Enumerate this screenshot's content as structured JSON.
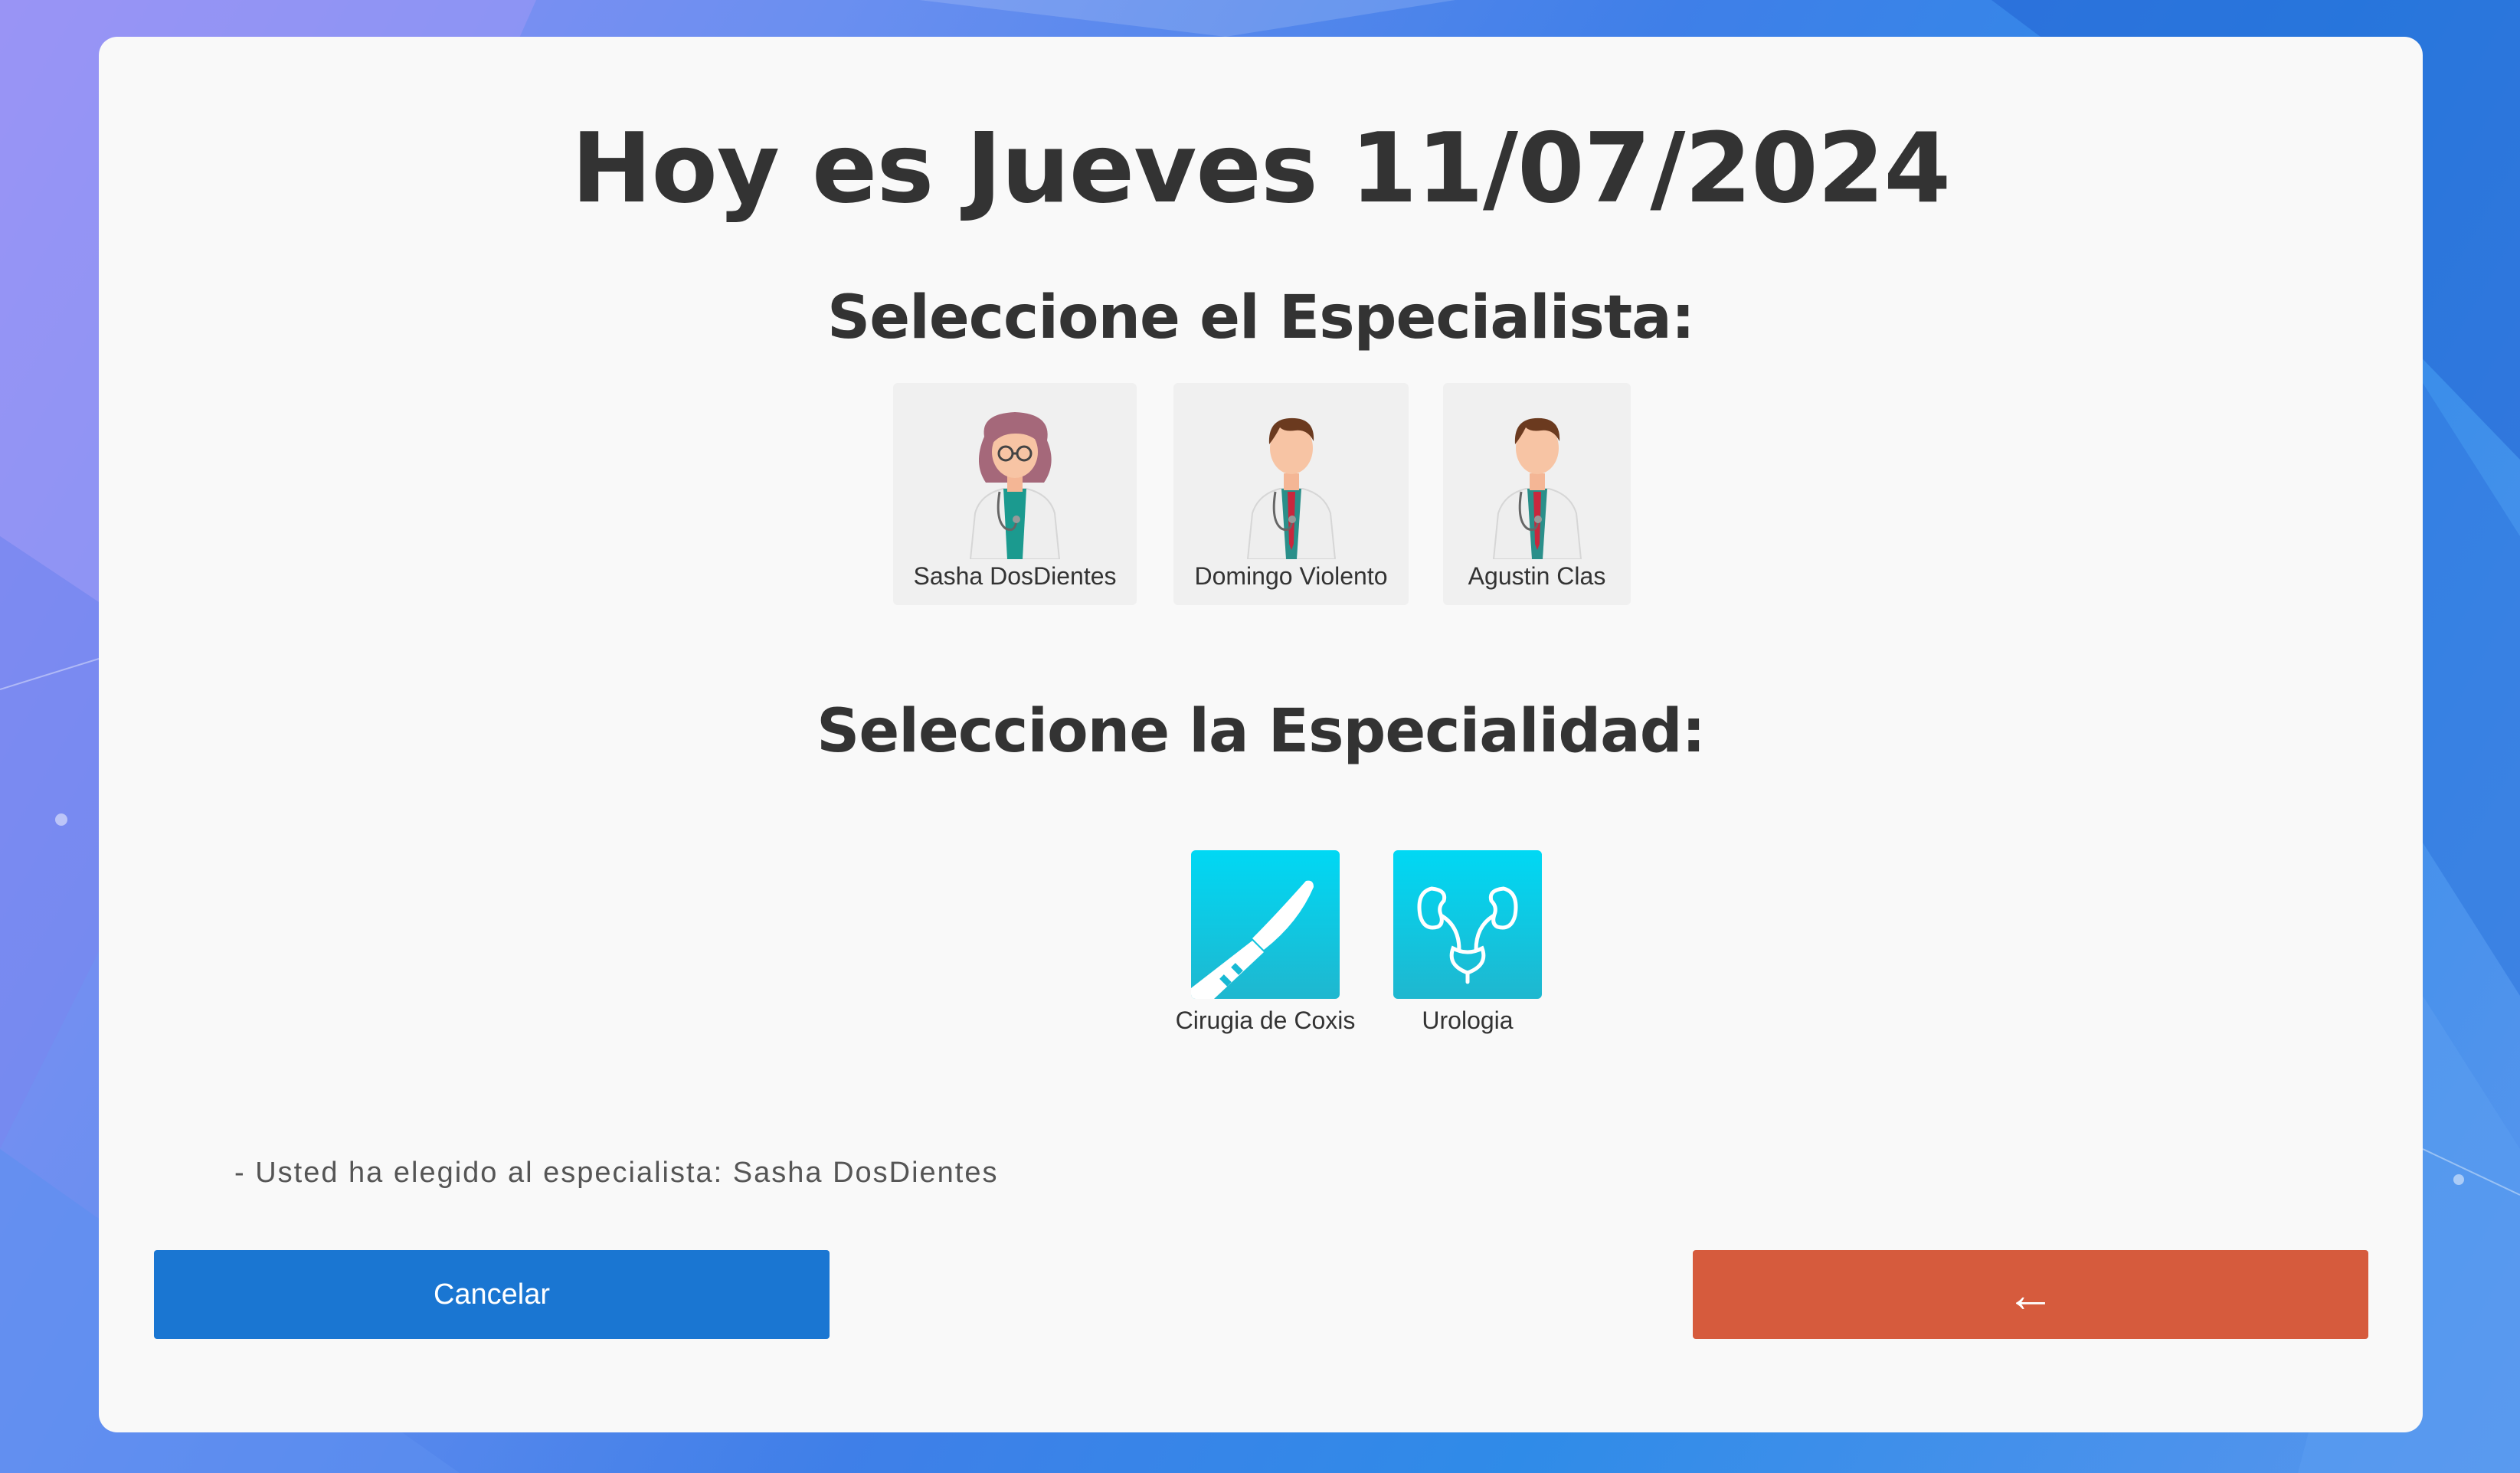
{
  "header": {
    "title": "Hoy es Jueves 11/07/2024"
  },
  "specialists": {
    "heading": "Seleccione el Especialista:",
    "items": [
      {
        "name": "Sasha DosDientes",
        "avatar": "female-doctor-avatar"
      },
      {
        "name": "Domingo Violento",
        "avatar": "male-doctor-avatar"
      },
      {
        "name": "Agustin Clas",
        "avatar": "male-doctor-avatar"
      }
    ]
  },
  "specialties": {
    "heading": "Seleccione la Especialidad:",
    "items": [
      {
        "label": "Cirugia de Coxis",
        "icon": "scalpel-icon"
      },
      {
        "label": "Urologia",
        "icon": "kidneys-icon"
      }
    ]
  },
  "selection_note": "- Usted ha elegido al especialista: Sasha DosDientes",
  "buttons": {
    "cancel_label": "Cancelar",
    "back_label": "←"
  },
  "colors": {
    "card_background": "#f9f9f9",
    "cancel_button": "#1a76d2",
    "back_button": "#d65b3d",
    "specialty_icon": "#11c6e2"
  }
}
